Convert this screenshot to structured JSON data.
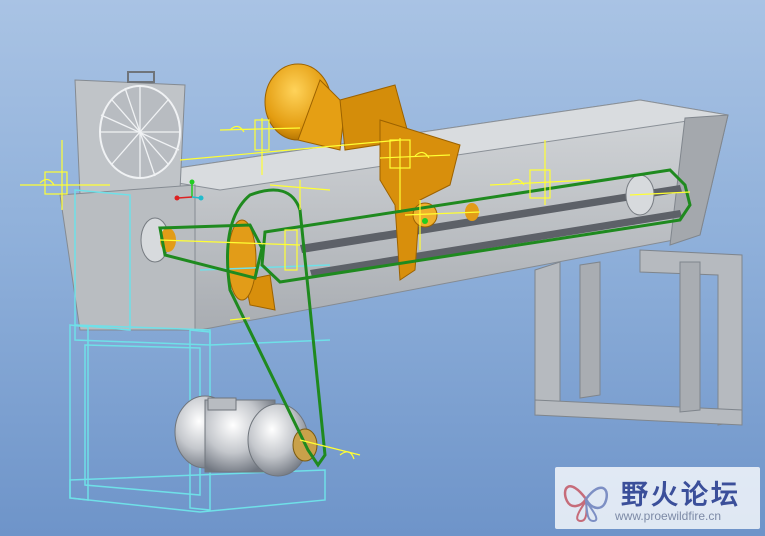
{
  "watermark": {
    "title": "野火论坛",
    "url": "www.proewildfire.cn",
    "logo_icon": "butterfly-logo-icon"
  },
  "colors": {
    "background_top": "#a9c3e4",
    "background_bottom": "#6e94c9",
    "housing": "#c4c8cc",
    "belt": "#1f8a1f",
    "hopper": "#e2a010",
    "frame_wire": "#6fe0e8",
    "datum_yellow": "#ffff33"
  }
}
